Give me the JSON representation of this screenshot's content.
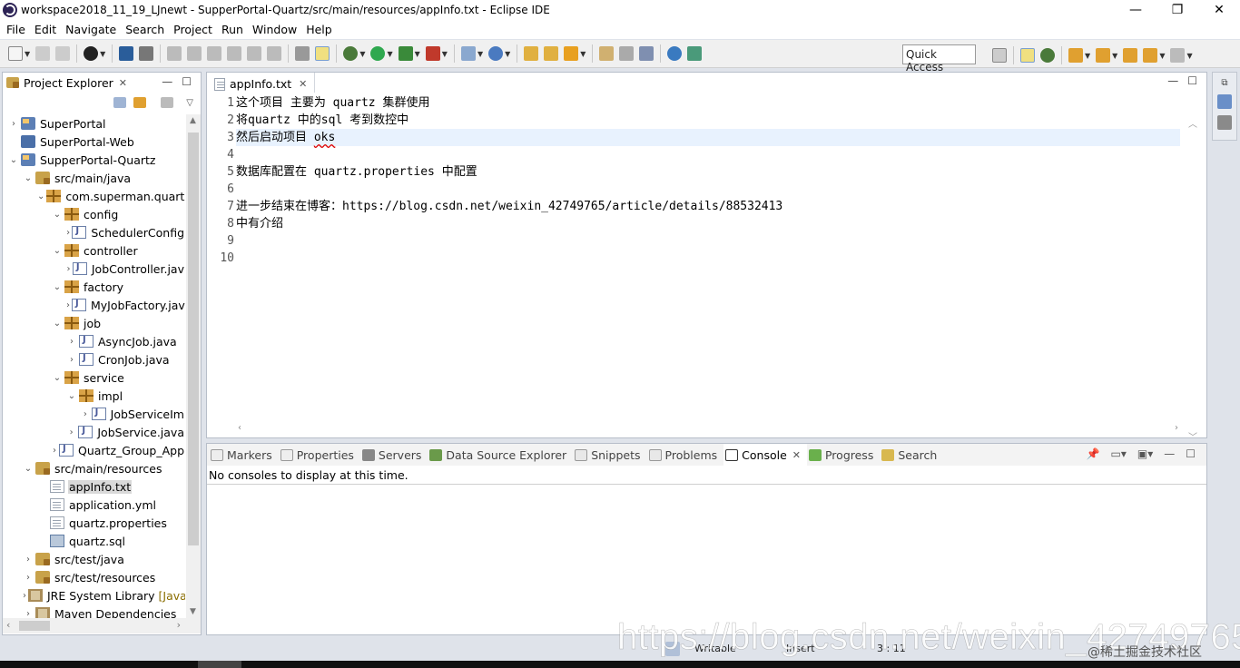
{
  "window": {
    "title": "workspace2018_11_19_LJnewt - SupperPortal-Quartz/src/main/resources/appInfo.txt - Eclipse IDE",
    "controls": [
      "—",
      "❐",
      "✕"
    ]
  },
  "menubar": {
    "items": [
      "File",
      "Edit",
      "Navigate",
      "Search",
      "Project",
      "Run",
      "Window",
      "Help"
    ]
  },
  "toolbar": {
    "quick_access": "Quick Access"
  },
  "project_explorer": {
    "tab_label": "Project Explorer",
    "tree": [
      {
        "label": "SuperPortal",
        "icon": "project-icon",
        "twisty": "›",
        "indent": 0
      },
      {
        "label": "SuperPortal-Web",
        "icon": "web-project-icon",
        "twisty": "",
        "indent": 0
      },
      {
        "label": "SupperPortal-Quartz",
        "icon": "project-icon",
        "twisty": "⌄",
        "indent": 0
      },
      {
        "label": "src/main/java",
        "icon": "source-folder-icon",
        "twisty": "⌄",
        "indent": 1
      },
      {
        "label": "com.superman.quartz",
        "icon": "package-icon",
        "twisty": "⌄",
        "indent": 2
      },
      {
        "label": "config",
        "icon": "package-icon",
        "twisty": "⌄",
        "indent": 3
      },
      {
        "label": "SchedulerConfig",
        "icon": "java-file-icon",
        "twisty": "›",
        "indent": 4
      },
      {
        "label": "controller",
        "icon": "package-icon",
        "twisty": "⌄",
        "indent": 3
      },
      {
        "label": "JobController.jav",
        "icon": "java-file-icon",
        "twisty": "›",
        "indent": 4
      },
      {
        "label": "factory",
        "icon": "package-icon",
        "twisty": "⌄",
        "indent": 3
      },
      {
        "label": "MyJobFactory.jav",
        "icon": "java-file-icon",
        "twisty": "›",
        "indent": 4
      },
      {
        "label": "job",
        "icon": "package-icon",
        "twisty": "⌄",
        "indent": 3
      },
      {
        "label": "AsyncJob.java",
        "icon": "java-file-icon",
        "twisty": "›",
        "indent": 4
      },
      {
        "label": "CronJob.java",
        "icon": "java-file-icon",
        "twisty": "›",
        "indent": 4
      },
      {
        "label": "service",
        "icon": "package-icon",
        "twisty": "⌄",
        "indent": 3
      },
      {
        "label": "impl",
        "icon": "package-icon",
        "twisty": "⌄",
        "indent": 4
      },
      {
        "label": "JobServiceIm",
        "icon": "java-file-icon",
        "twisty": "›",
        "indent": 5
      },
      {
        "label": "JobService.java",
        "icon": "java-file-icon",
        "twisty": "›",
        "indent": 4
      },
      {
        "label": "Quartz_Group_App",
        "icon": "java-file-icon",
        "twisty": "›",
        "indent": 3
      },
      {
        "label": "src/main/resources",
        "icon": "source-folder-icon",
        "twisty": "⌄",
        "indent": 1
      },
      {
        "label": "appInfo.txt",
        "icon": "text-file-icon",
        "twisty": "",
        "indent": 2,
        "selected": true
      },
      {
        "label": "application.yml",
        "icon": "text-file-icon",
        "twisty": "",
        "indent": 2
      },
      {
        "label": "quartz.properties",
        "icon": "text-file-icon",
        "twisty": "",
        "indent": 2
      },
      {
        "label": "quartz.sql",
        "icon": "sql-file-icon",
        "twisty": "",
        "indent": 2
      },
      {
        "label": "src/test/java",
        "icon": "source-folder-icon",
        "twisty": "›",
        "indent": 1
      },
      {
        "label": "src/test/resources",
        "icon": "source-folder-icon",
        "twisty": "›",
        "indent": 1
      },
      {
        "label": "JRE System Library",
        "decoration": "[Java",
        "icon": "library-icon",
        "twisty": "›",
        "indent": 1
      },
      {
        "label": "Maven Dependencies",
        "icon": "library-icon",
        "twisty": "›",
        "indent": 1
      }
    ]
  },
  "editor": {
    "tab_label": "appInfo.txt",
    "current_line": 3,
    "lines": [
      {
        "num": "1",
        "text": "这个项目 主要为 quartz 集群使用"
      },
      {
        "num": "2",
        "text": "将quartz 中的sql 考到数控中"
      },
      {
        "num": "3",
        "text": "然后启动项目 ",
        "squiggle": "oks"
      },
      {
        "num": "4",
        "text": ""
      },
      {
        "num": "5",
        "text": "数据库配置在 quartz.properties 中配置"
      },
      {
        "num": "6",
        "text": ""
      },
      {
        "num": "7",
        "text": "进一步结束在博客：https://blog.csdn.net/weixin_42749765/article/details/88532413"
      },
      {
        "num": "8",
        "text": "中有介绍"
      },
      {
        "num": "9",
        "text": ""
      },
      {
        "num": "10",
        "text": ""
      }
    ]
  },
  "bottom_panel": {
    "tabs": [
      {
        "label": "Markers",
        "icon": "markers-icon"
      },
      {
        "label": "Properties",
        "icon": "properties-icon"
      },
      {
        "label": "Servers",
        "icon": "servers-icon"
      },
      {
        "label": "Data Source Explorer",
        "icon": "data-source-explorer-icon"
      },
      {
        "label": "Snippets",
        "icon": "snippets-icon"
      },
      {
        "label": "Problems",
        "icon": "problems-icon"
      },
      {
        "label": "Console",
        "icon": "console-icon",
        "active": true
      },
      {
        "label": "Progress",
        "icon": "progress-icon"
      },
      {
        "label": "Search",
        "icon": "search-icon"
      }
    ],
    "console_message": "No consoles to display at this time."
  },
  "statusbar": {
    "writable": "Writable",
    "insert_mode": "Insert",
    "position": "3 : 11"
  },
  "watermark": {
    "url": "https://blog.csdn.net/weixin_42749765",
    "credit": "@稀土掘金技术社区"
  },
  "colors": {
    "accent": "#4a6fa8",
    "current_line": "#e8f2fe",
    "panel_border": "#b7bec9"
  }
}
